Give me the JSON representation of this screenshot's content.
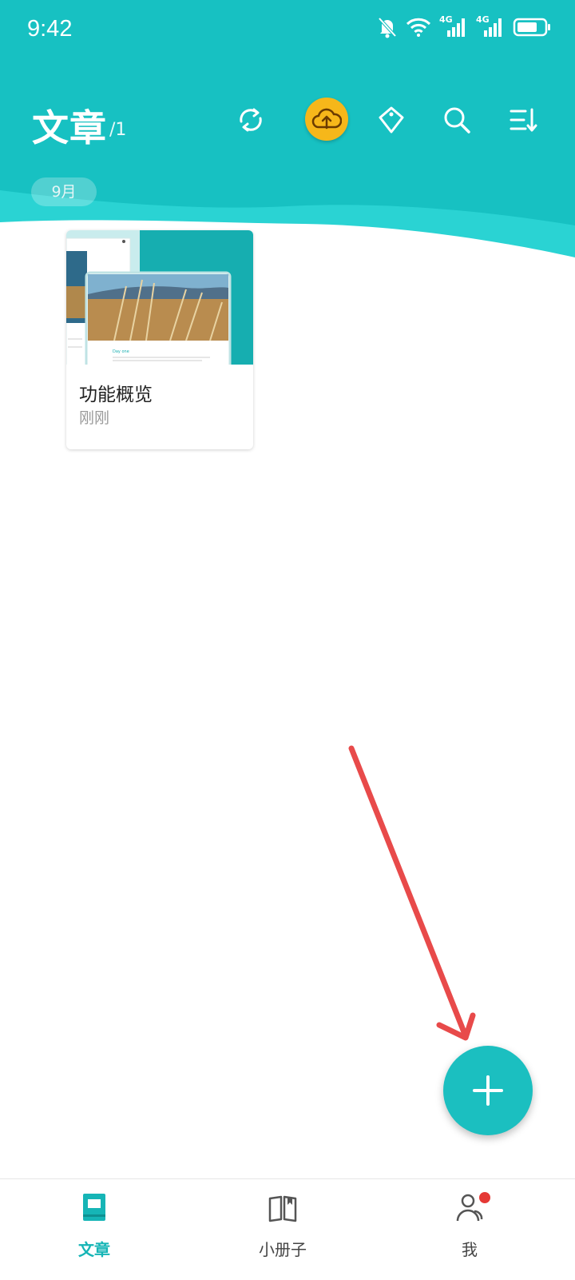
{
  "status_bar": {
    "time": "9:42",
    "signal_label_1": "4G",
    "signal_label_2": "4G"
  },
  "header": {
    "title": "文章",
    "count": "/1"
  },
  "section": {
    "month_label": "9月"
  },
  "articles": [
    {
      "title": "功能概览",
      "time": "刚刚",
      "preview_heading": "Day one"
    }
  ],
  "tabs": [
    {
      "label": "文章",
      "active": true
    },
    {
      "label": "小册子",
      "active": false
    },
    {
      "label": "我",
      "active": false
    }
  ],
  "colors": {
    "primary": "#1bbfc0",
    "upload": "#f6b71a",
    "annotation_arrow": "#e84a4a"
  },
  "icons": [
    "sync-icon",
    "cloud-upload-icon",
    "tag-icon",
    "search-icon",
    "sort-icon",
    "plus-icon",
    "article-icon",
    "book-icon",
    "profile-icon"
  ]
}
